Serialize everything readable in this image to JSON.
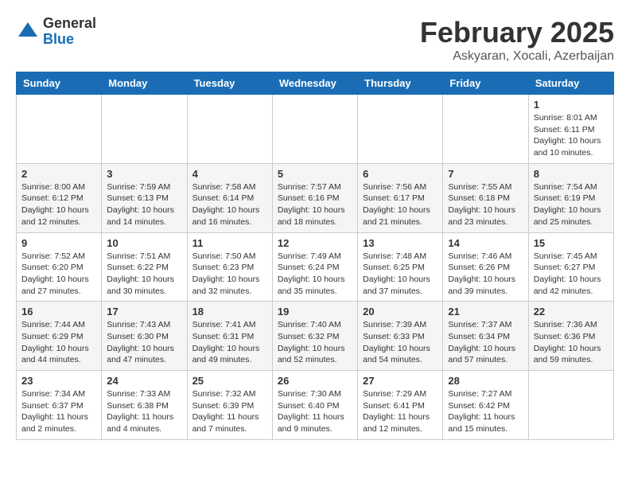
{
  "header": {
    "logo_general": "General",
    "logo_blue": "Blue",
    "title": "February 2025",
    "subtitle": "Askyaran, Xocali, Azerbaijan"
  },
  "calendar": {
    "days_of_week": [
      "Sunday",
      "Monday",
      "Tuesday",
      "Wednesday",
      "Thursday",
      "Friday",
      "Saturday"
    ],
    "weeks": [
      [
        {
          "day": "",
          "info": ""
        },
        {
          "day": "",
          "info": ""
        },
        {
          "day": "",
          "info": ""
        },
        {
          "day": "",
          "info": ""
        },
        {
          "day": "",
          "info": ""
        },
        {
          "day": "",
          "info": ""
        },
        {
          "day": "1",
          "info": "Sunrise: 8:01 AM\nSunset: 6:11 PM\nDaylight: 10 hours\nand 10 minutes."
        }
      ],
      [
        {
          "day": "2",
          "info": "Sunrise: 8:00 AM\nSunset: 6:12 PM\nDaylight: 10 hours\nand 12 minutes."
        },
        {
          "day": "3",
          "info": "Sunrise: 7:59 AM\nSunset: 6:13 PM\nDaylight: 10 hours\nand 14 minutes."
        },
        {
          "day": "4",
          "info": "Sunrise: 7:58 AM\nSunset: 6:14 PM\nDaylight: 10 hours\nand 16 minutes."
        },
        {
          "day": "5",
          "info": "Sunrise: 7:57 AM\nSunset: 6:16 PM\nDaylight: 10 hours\nand 18 minutes."
        },
        {
          "day": "6",
          "info": "Sunrise: 7:56 AM\nSunset: 6:17 PM\nDaylight: 10 hours\nand 21 minutes."
        },
        {
          "day": "7",
          "info": "Sunrise: 7:55 AM\nSunset: 6:18 PM\nDaylight: 10 hours\nand 23 minutes."
        },
        {
          "day": "8",
          "info": "Sunrise: 7:54 AM\nSunset: 6:19 PM\nDaylight: 10 hours\nand 25 minutes."
        }
      ],
      [
        {
          "day": "9",
          "info": "Sunrise: 7:52 AM\nSunset: 6:20 PM\nDaylight: 10 hours\nand 27 minutes."
        },
        {
          "day": "10",
          "info": "Sunrise: 7:51 AM\nSunset: 6:22 PM\nDaylight: 10 hours\nand 30 minutes."
        },
        {
          "day": "11",
          "info": "Sunrise: 7:50 AM\nSunset: 6:23 PM\nDaylight: 10 hours\nand 32 minutes."
        },
        {
          "day": "12",
          "info": "Sunrise: 7:49 AM\nSunset: 6:24 PM\nDaylight: 10 hours\nand 35 minutes."
        },
        {
          "day": "13",
          "info": "Sunrise: 7:48 AM\nSunset: 6:25 PM\nDaylight: 10 hours\nand 37 minutes."
        },
        {
          "day": "14",
          "info": "Sunrise: 7:46 AM\nSunset: 6:26 PM\nDaylight: 10 hours\nand 39 minutes."
        },
        {
          "day": "15",
          "info": "Sunrise: 7:45 AM\nSunset: 6:27 PM\nDaylight: 10 hours\nand 42 minutes."
        }
      ],
      [
        {
          "day": "16",
          "info": "Sunrise: 7:44 AM\nSunset: 6:29 PM\nDaylight: 10 hours\nand 44 minutes."
        },
        {
          "day": "17",
          "info": "Sunrise: 7:43 AM\nSunset: 6:30 PM\nDaylight: 10 hours\nand 47 minutes."
        },
        {
          "day": "18",
          "info": "Sunrise: 7:41 AM\nSunset: 6:31 PM\nDaylight: 10 hours\nand 49 minutes."
        },
        {
          "day": "19",
          "info": "Sunrise: 7:40 AM\nSunset: 6:32 PM\nDaylight: 10 hours\nand 52 minutes."
        },
        {
          "day": "20",
          "info": "Sunrise: 7:39 AM\nSunset: 6:33 PM\nDaylight: 10 hours\nand 54 minutes."
        },
        {
          "day": "21",
          "info": "Sunrise: 7:37 AM\nSunset: 6:34 PM\nDaylight: 10 hours\nand 57 minutes."
        },
        {
          "day": "22",
          "info": "Sunrise: 7:36 AM\nSunset: 6:36 PM\nDaylight: 10 hours\nand 59 minutes."
        }
      ],
      [
        {
          "day": "23",
          "info": "Sunrise: 7:34 AM\nSunset: 6:37 PM\nDaylight: 11 hours\nand 2 minutes."
        },
        {
          "day": "24",
          "info": "Sunrise: 7:33 AM\nSunset: 6:38 PM\nDaylight: 11 hours\nand 4 minutes."
        },
        {
          "day": "25",
          "info": "Sunrise: 7:32 AM\nSunset: 6:39 PM\nDaylight: 11 hours\nand 7 minutes."
        },
        {
          "day": "26",
          "info": "Sunrise: 7:30 AM\nSunset: 6:40 PM\nDaylight: 11 hours\nand 9 minutes."
        },
        {
          "day": "27",
          "info": "Sunrise: 7:29 AM\nSunset: 6:41 PM\nDaylight: 11 hours\nand 12 minutes."
        },
        {
          "day": "28",
          "info": "Sunrise: 7:27 AM\nSunset: 6:42 PM\nDaylight: 11 hours\nand 15 minutes."
        },
        {
          "day": "",
          "info": ""
        }
      ]
    ]
  }
}
